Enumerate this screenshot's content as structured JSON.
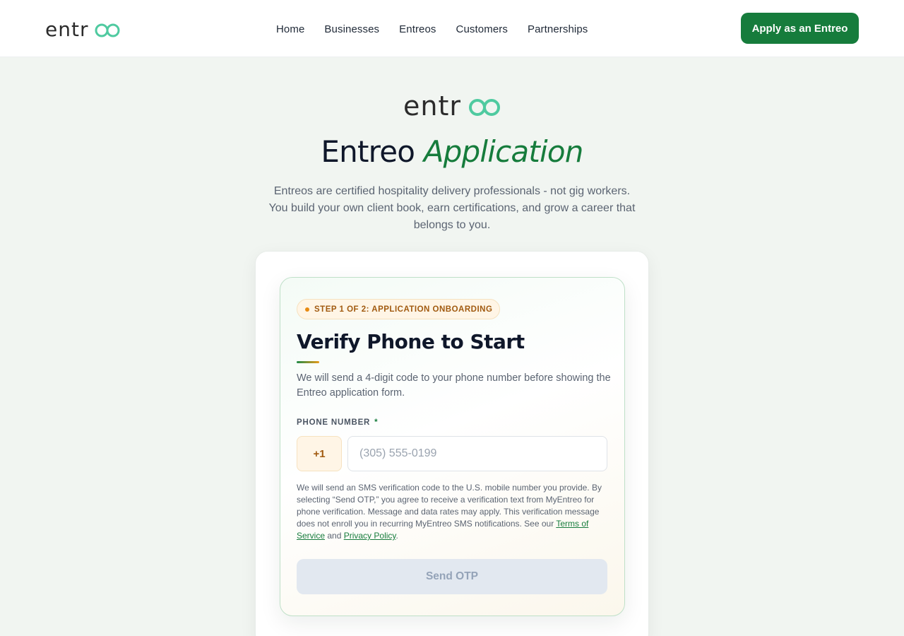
{
  "brand": {
    "logo_text": "entreo",
    "colors": {
      "dark": "#2b2b2b",
      "accent": "#4fcaa0",
      "primary": "#167c3c"
    }
  },
  "nav": {
    "items": [
      "Home",
      "Businesses",
      "Entreos",
      "Customers",
      "Partnerships"
    ],
    "cta_label": "Apply as an Entreo"
  },
  "hero": {
    "title_plain": "Entreo",
    "title_accent": "Application",
    "subtitle": "Entreos are certified hospitality delivery professionals - not gig workers. You build your own client book, earn certifications, and grow a career that belongs to you."
  },
  "form": {
    "step_badge": "STEP 1 OF 2: APPLICATION ONBOARDING",
    "title": "Verify Phone to Start",
    "description": "We will send a 4-digit code to your phone number before showing the Entreo application form.",
    "phone_label": "PHONE NUMBER",
    "required_mark": "*",
    "country_code": "+1",
    "phone_placeholder": "(305) 555-0199",
    "phone_value": "",
    "legal_text": "We will send an SMS verification code to the U.S. mobile number you provide. By selecting “Send OTP,” you agree to receive a verification text from MyEntreo for phone verification. Message and data rates may apply. This verification message does not enroll you in recurring MyEntreo SMS notifications. See our ",
    "terms_link": "Terms of Service",
    "legal_and": " and ",
    "privacy_link": "Privacy Policy",
    "legal_end": ".",
    "send_button": "Send OTP",
    "send_disabled": true
  }
}
